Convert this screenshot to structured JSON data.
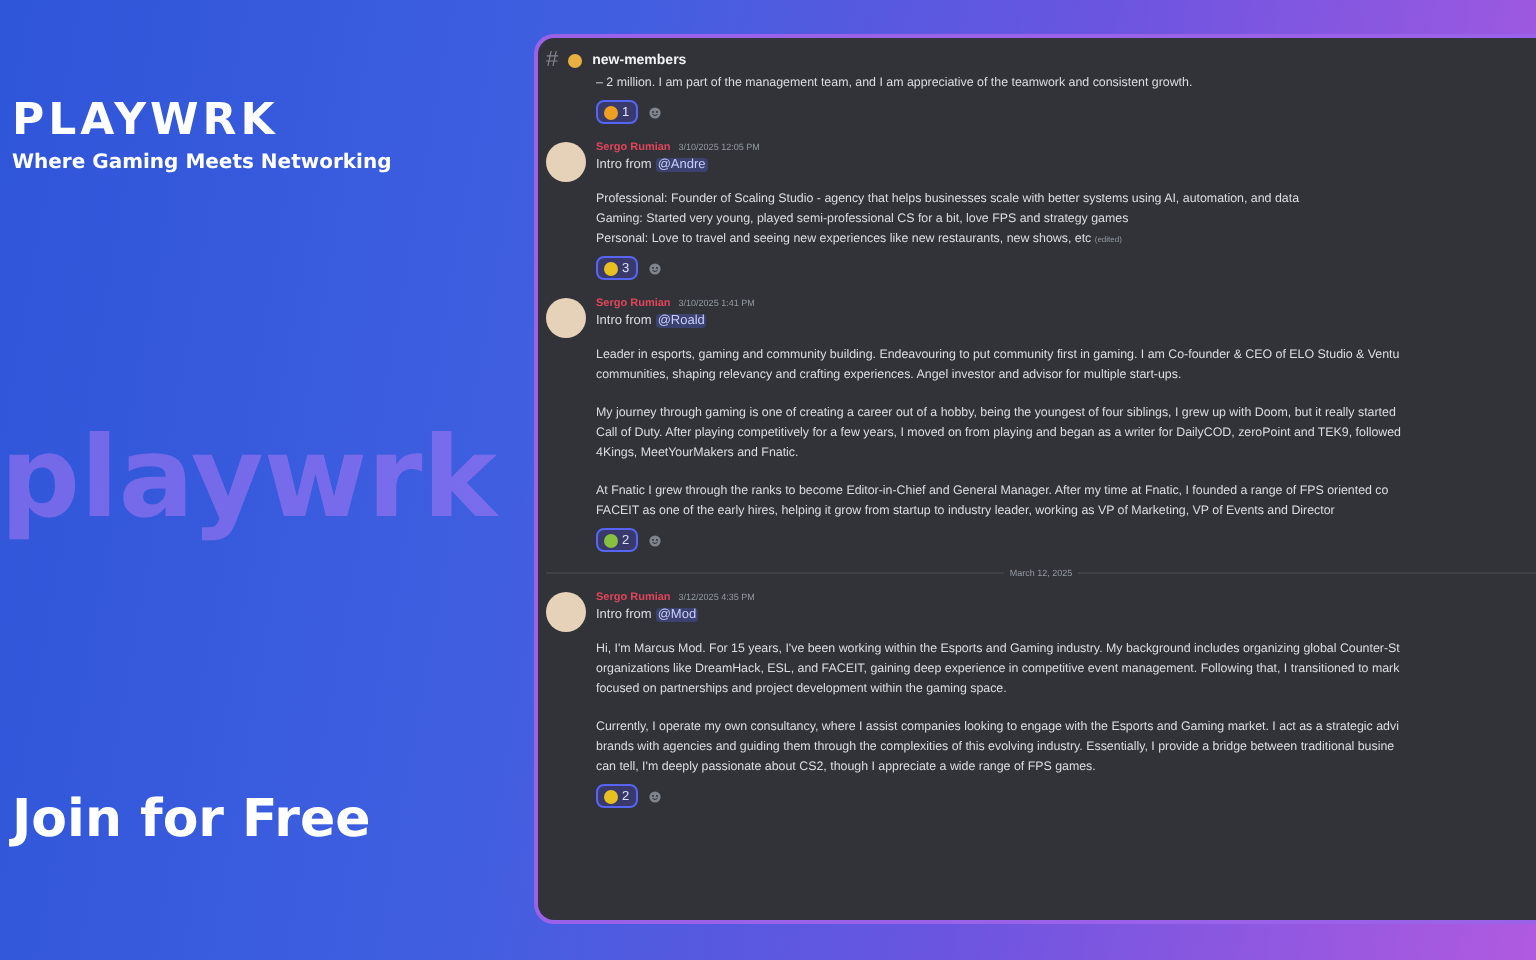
{
  "promo": {
    "wordmark": "playwrk",
    "brand": "PLAYWRK",
    "tagline": "Where Gaming Meets Networking",
    "cta": "Join for Free"
  },
  "channel": {
    "hash": "#",
    "name": "new-members"
  },
  "messages": [
    {
      "kind": "continuation",
      "paragraphs": [
        "– 2 million. I am part of the management team, and I am appreciative of the teamwork and consistent growth."
      ],
      "reactions": [
        {
          "count": "1",
          "selected": true,
          "color": "#f0a020"
        }
      ]
    },
    {
      "kind": "message",
      "author": "Sergo Rumian",
      "time": "3/10/2025 12:05 PM",
      "intro": "Intro from",
      "mention": "@Andre",
      "paragraphs": [
        "Professional: Founder of Scaling Studio - agency that helps businesses scale with better systems using AI, automation, and data\nGaming: Started very young, played semi-professional CS for a bit, love FPS and strategy games\nPersonal: Love to travel and seeing new experiences like new restaurants, new shows, etc"
      ],
      "edited": "(edited)",
      "reactions": [
        {
          "count": "3",
          "selected": true,
          "color": "#e8c020"
        }
      ]
    },
    {
      "kind": "message",
      "author": "Sergo Rumian",
      "time": "3/10/2025 1:41 PM",
      "intro": "Intro from",
      "mention": "@Roald",
      "paragraphs": [
        "Leader in esports, gaming and community building. Endeavouring to put community first in gaming. I am Co-founder & CEO of ELO Studio & Ventu\ncommunities, shaping relevancy and crafting experiences. Angel investor and advisor for multiple start-ups.",
        "My journey through gaming is one of creating a career out of a hobby, being the youngest of four siblings, I grew up with Doom, but it really started\nCall of Duty. After playing competitively for a few years, I moved on from playing and began as a writer for DailyCOD, zeroPoint and TEK9, followed\n4Kings, MeetYourMakers and Fnatic.",
        "At Fnatic I grew through the ranks to become Editor-in-Chief and General Manager. After my time at Fnatic, I founded a range of FPS oriented co\nFACEIT as one of the early hires, helping it grow from startup to industry leader, working as VP of Marketing, VP of Events and Director"
      ],
      "reactions": [
        {
          "count": "2",
          "selected": true,
          "color": "#8ac040"
        }
      ]
    },
    {
      "kind": "divider",
      "date": "March 12, 2025"
    },
    {
      "kind": "message",
      "author": "Sergo Rumian",
      "time": "3/12/2025 4:35 PM",
      "intro": "Intro from",
      "mention": "@Mod",
      "paragraphs": [
        "Hi, I'm Marcus Mod. For 15 years, I've been working within the Esports and Gaming industry. My background includes organizing global Counter-St\norganizations like DreamHack, ESL, and FACEIT, gaining deep experience in competitive event management. Following that, I transitioned to mark\nfocused on partnerships and project development within the gaming space.",
        "Currently, I operate my own consultancy, where I assist companies looking to engage with the Esports and Gaming market. I act as a strategic advi\nbrands with agencies and guiding them through the complexities of this evolving industry. Essentially, I provide a bridge between traditional busine\ncan tell, I'm deeply passionate about CS2, though I appreciate a wide range of FPS games."
      ],
      "reactions": [
        {
          "count": "2",
          "selected": true,
          "color": "#e8c020"
        }
      ]
    }
  ]
}
